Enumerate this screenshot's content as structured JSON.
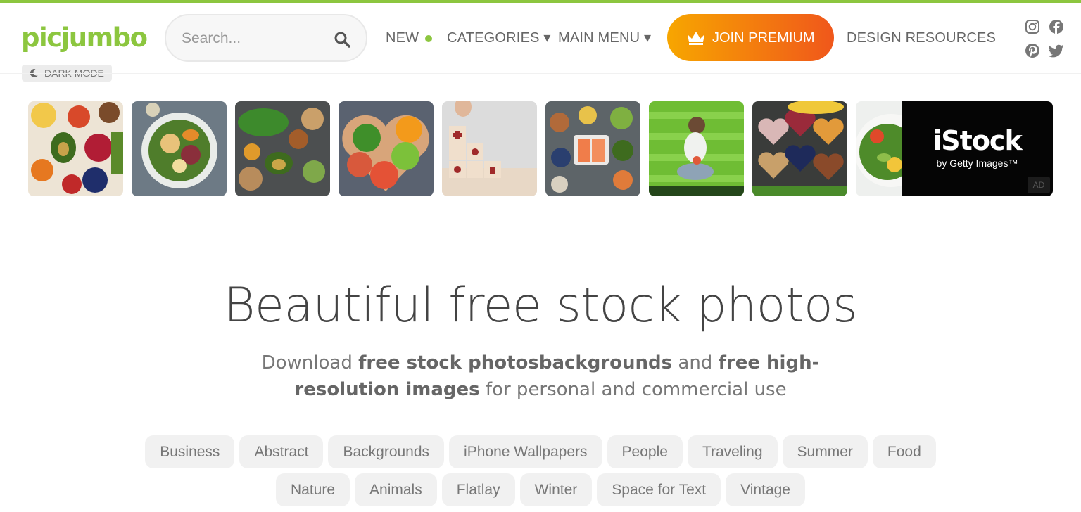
{
  "colors": {
    "brand_green": "#8cc63f",
    "premium_from": "#f7a600",
    "premium_to": "#f0571b",
    "text": "#555555",
    "tag_bg": "#f1f1f1"
  },
  "header": {
    "logo": "picjumbo",
    "search_placeholder": "Search...",
    "nav": {
      "new": "NEW",
      "categories": "CATEGORIES ▾",
      "main_menu": "MAIN MENU ▾",
      "premium": "JOIN PREMIUM",
      "design_resources": "DESIGN RESOURCES"
    },
    "social": [
      "instagram-icon",
      "facebook-icon",
      "pinterest-icon",
      "twitter-icon"
    ],
    "dark_mode": "DARK MODE"
  },
  "photos": [
    {
      "subject": "vegetables and fruits flatlay"
    },
    {
      "subject": "salad bowl"
    },
    {
      "subject": "healthy superfood spread"
    },
    {
      "subject": "hands holding fruit heart bowl"
    },
    {
      "subject": "medical wooden blocks"
    },
    {
      "subject": "salmon and vegetables"
    },
    {
      "subject": "woman on green picnic blanket"
    },
    {
      "subject": "superfood heart bowls"
    },
    {
      "subject": "salad plate"
    }
  ],
  "ad": {
    "brand": "iStock",
    "sub": "by Getty Images™",
    "badge": "AD"
  },
  "hero": {
    "title": "Beautiful free stock photos",
    "sub": {
      "t1": "Download ",
      "b1": "free stock photos",
      ", ": ", ",
      "b2": "backgrounds",
      "t2": " and ",
      "b3": "free high-resolution images",
      "t3": " for personal and commercial use"
    }
  },
  "tags_row1": [
    "Business",
    "Abstract",
    "Backgrounds",
    "iPhone Wallpapers",
    "People",
    "Traveling",
    "Summer",
    "Food"
  ],
  "tags_row2": [
    "Nature",
    "Animals",
    "Flatlay",
    "Winter",
    "Space for Text",
    "Vintage"
  ]
}
